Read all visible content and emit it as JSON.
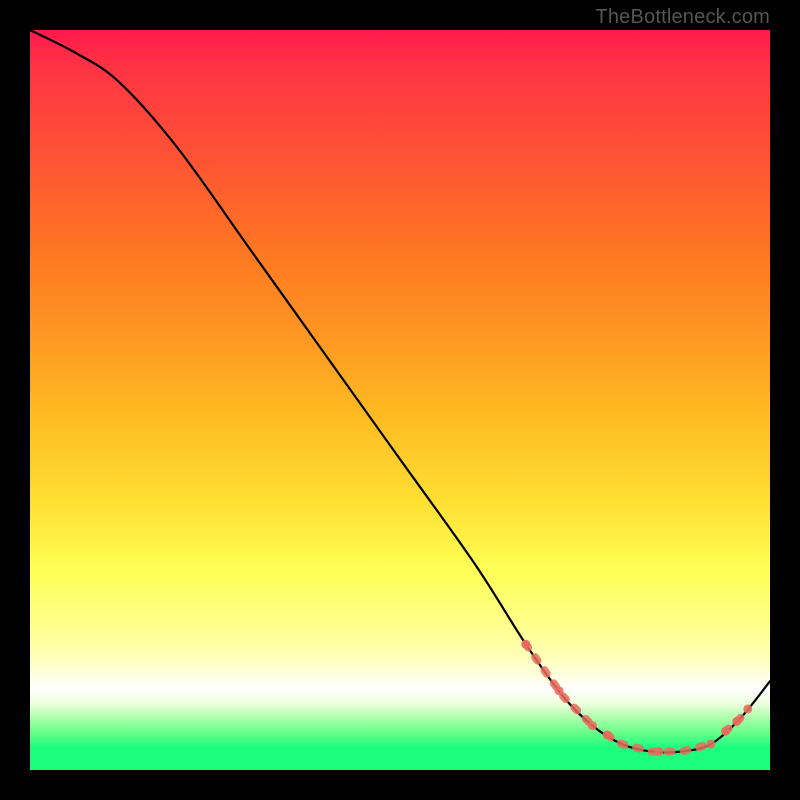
{
  "watermark": "TheBottleneck.com",
  "colors": {
    "curve": "#000000",
    "accent": "#e86c5e",
    "bg_top": "#ff1a4d",
    "bg_bottom": "#1cfd7e"
  },
  "chart_data": {
    "type": "line",
    "title": "",
    "xlabel": "",
    "ylabel": "",
    "xlim": [
      0,
      100
    ],
    "ylim": [
      0,
      100
    ],
    "grid": false,
    "series": [
      {
        "name": "curve",
        "x": [
          0,
          6,
          12,
          20,
          30,
          40,
          50,
          60,
          67,
          72,
          76,
          80,
          84,
          88,
          92,
          96,
          100
        ],
        "values": [
          100,
          97,
          93,
          84,
          70,
          56,
          42,
          28,
          17,
          10,
          6,
          3.5,
          2.5,
          2.5,
          3.5,
          7,
          12
        ]
      }
    ],
    "highlight_segments": [
      {
        "name": "descent-band",
        "x_start": 67,
        "x_end": 76
      },
      {
        "name": "valley-floor",
        "x_start": 78,
        "x_end": 92
      },
      {
        "name": "upturn-band",
        "x_start": 94,
        "x_end": 97
      }
    ]
  }
}
